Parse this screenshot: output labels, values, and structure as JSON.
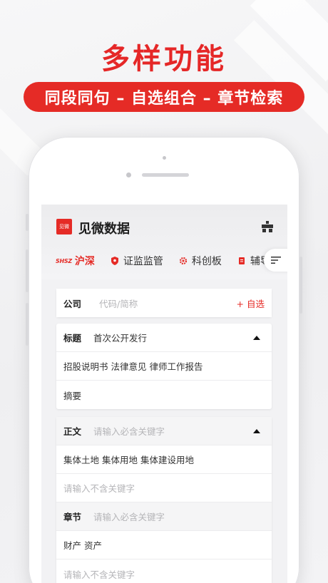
{
  "promo": {
    "headline": "多样功能",
    "banner": "同段同句 – 自选组合 – 章节检索"
  },
  "app": {
    "logo_text": "见微",
    "title": "见微数据"
  },
  "tabs": [
    {
      "prefix": "SHSZ",
      "label": "沪深",
      "active": true
    },
    {
      "label": "证监监管",
      "icon": "shield-icon"
    },
    {
      "label": "科创板",
      "icon": "gear-icon"
    },
    {
      "label": "辅导",
      "icon": "document-icon"
    }
  ],
  "company_row": {
    "label": "公司",
    "placeholder": "代码/简称",
    "add_label": "+ 自选"
  },
  "title_section": {
    "label": "标题",
    "value": "首次公开发行",
    "items": [
      "招股说明书 法律意见 律师工作报告",
      "摘要"
    ]
  },
  "body_section": {
    "label": "正文",
    "include_placeholder": "请输入必含关键字",
    "include_value": "集体土地 集体用地 集体建设用地",
    "exclude_placeholder": "请输入不含关键字"
  },
  "chapter_section": {
    "label": "章节",
    "include_placeholder": "请输入必含关键字",
    "include_value": "财产 资产",
    "exclude_placeholder": "请输入不含关键字"
  },
  "colors": {
    "accent": "#e52b26",
    "headline": "#e52727",
    "background": "#f2f2f4"
  }
}
